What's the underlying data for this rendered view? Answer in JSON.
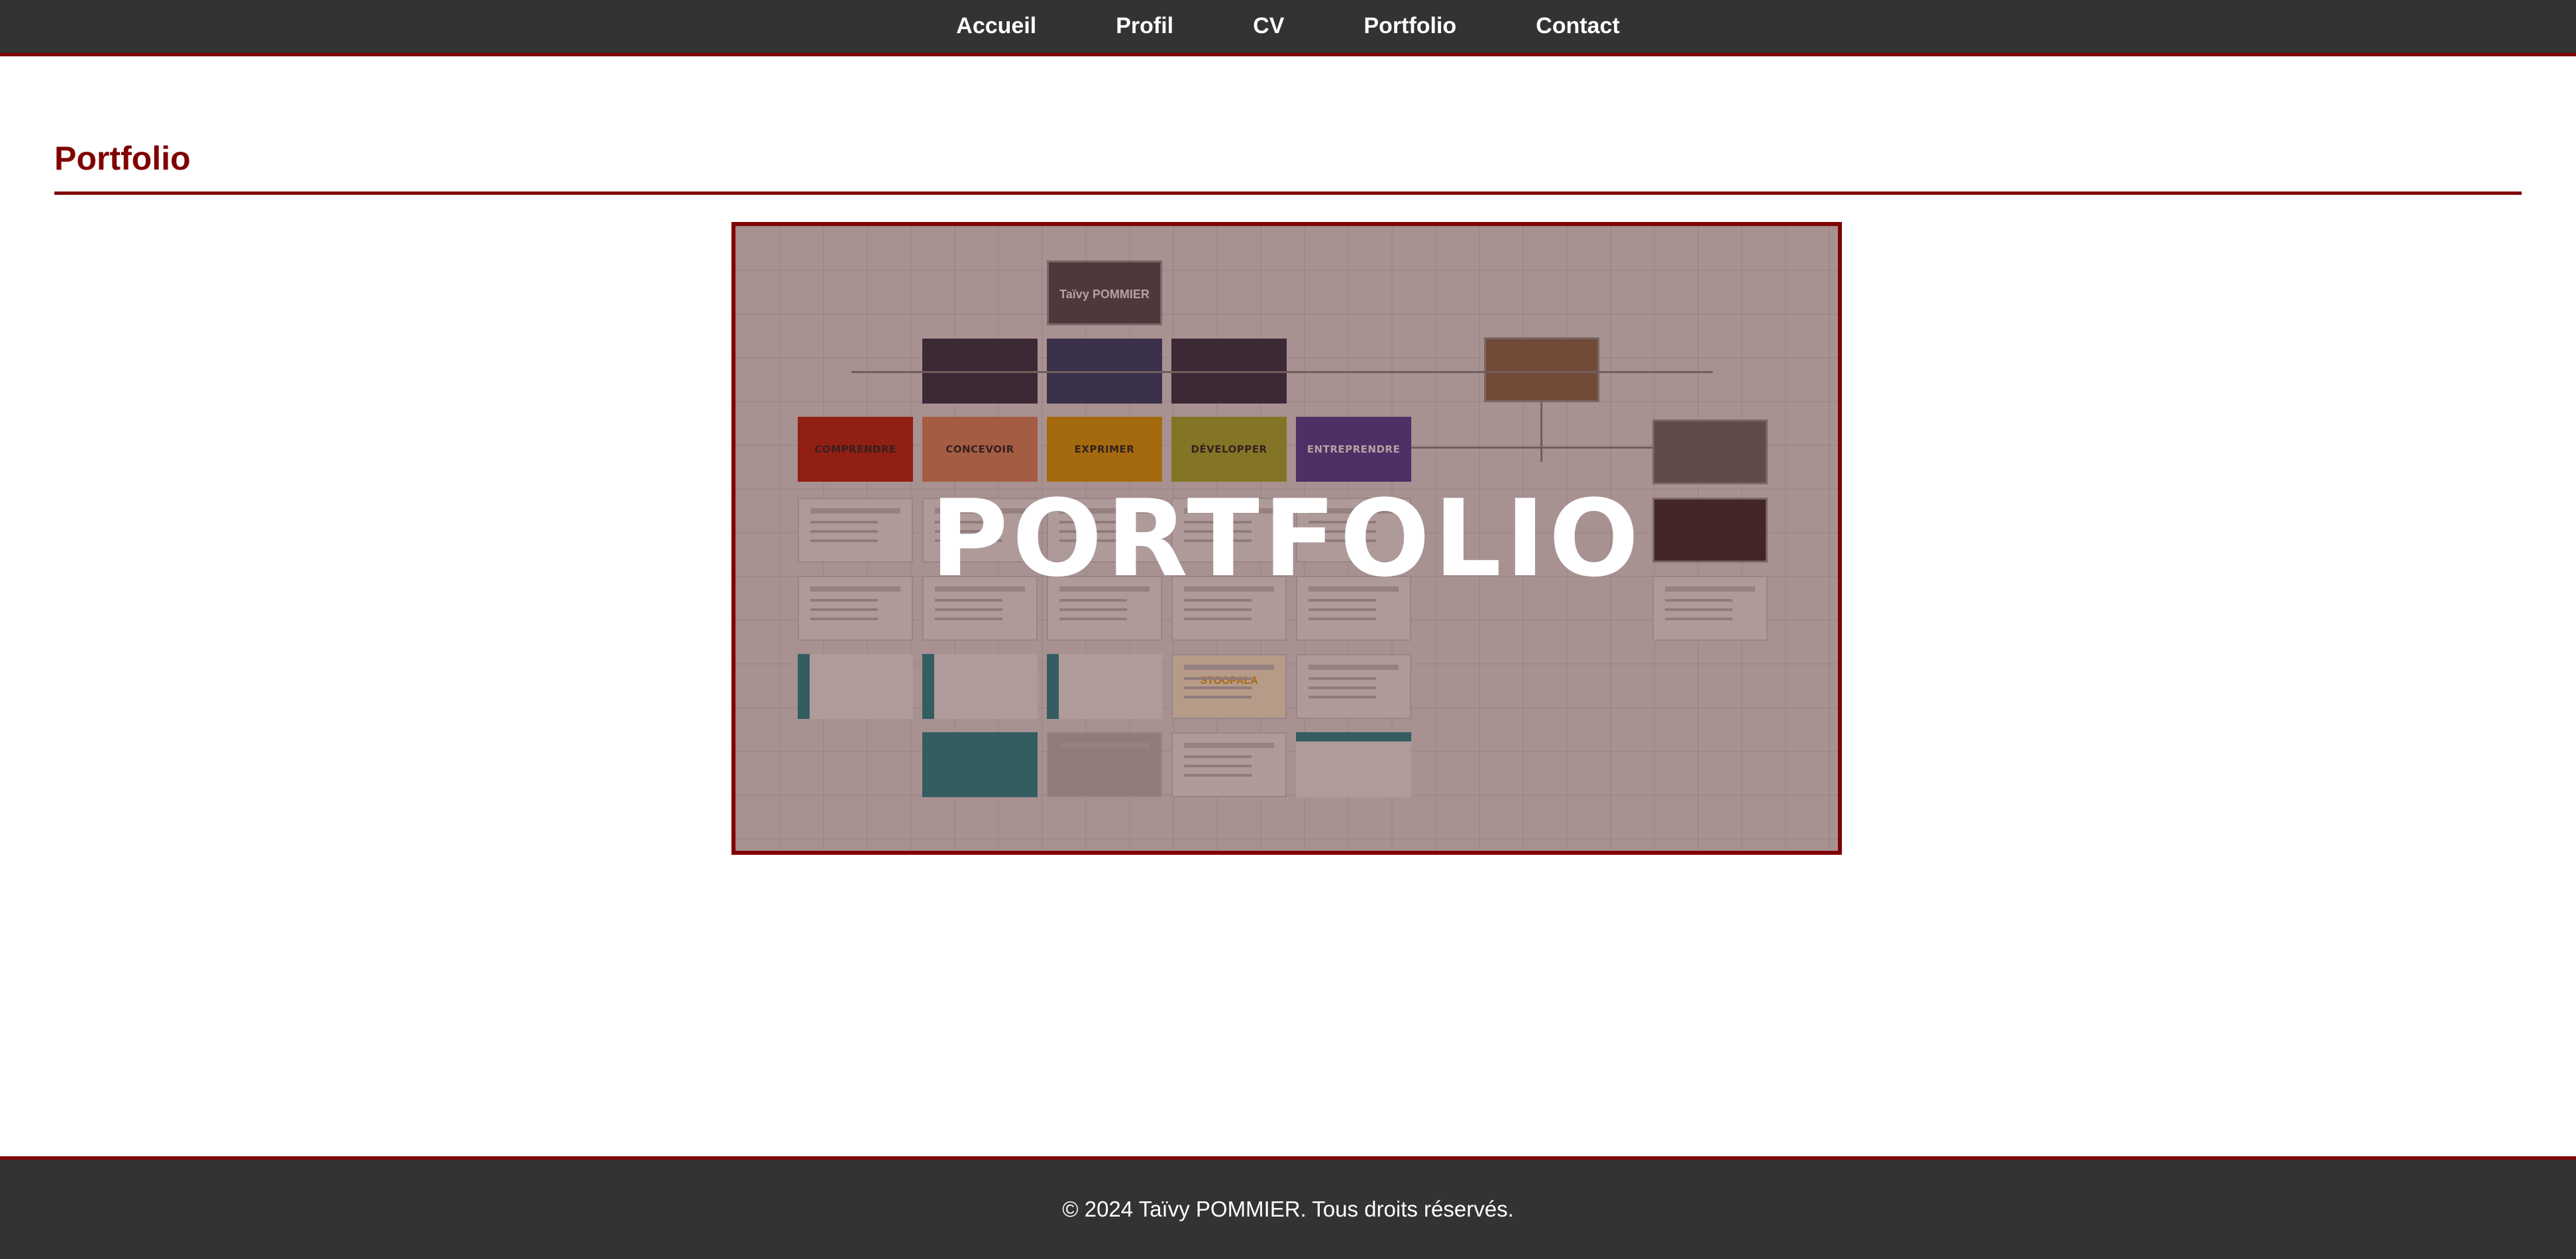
{
  "nav": {
    "items": [
      {
        "label": "Accueil"
      },
      {
        "label": "Profil"
      },
      {
        "label": "CV"
      },
      {
        "label": "Portfolio"
      },
      {
        "label": "Contact"
      }
    ]
  },
  "section": {
    "title": "Portfolio"
  },
  "preview": {
    "overlay_title": "PORTFOLIO",
    "name_tile": "Taïvy POMMIER",
    "categories": [
      {
        "label": "COMPRENDRE",
        "color": "#c0200b"
      },
      {
        "label": "CONCEVOIR",
        "color": "#e08a5e"
      },
      {
        "label": "EXPRIMER",
        "color": "#e2a100"
      },
      {
        "label": "DÉVELOPPER",
        "color": "#a7b32a"
      },
      {
        "label": "ENTREPRENDRE",
        "color": "#4a3d9a"
      }
    ],
    "badge": "STOOPALA"
  },
  "footer": {
    "text": "© 2024 Taïvy POMMIER. Tous droits réservés."
  },
  "colors": {
    "accent": "#800000",
    "nav_bg": "#333333"
  }
}
